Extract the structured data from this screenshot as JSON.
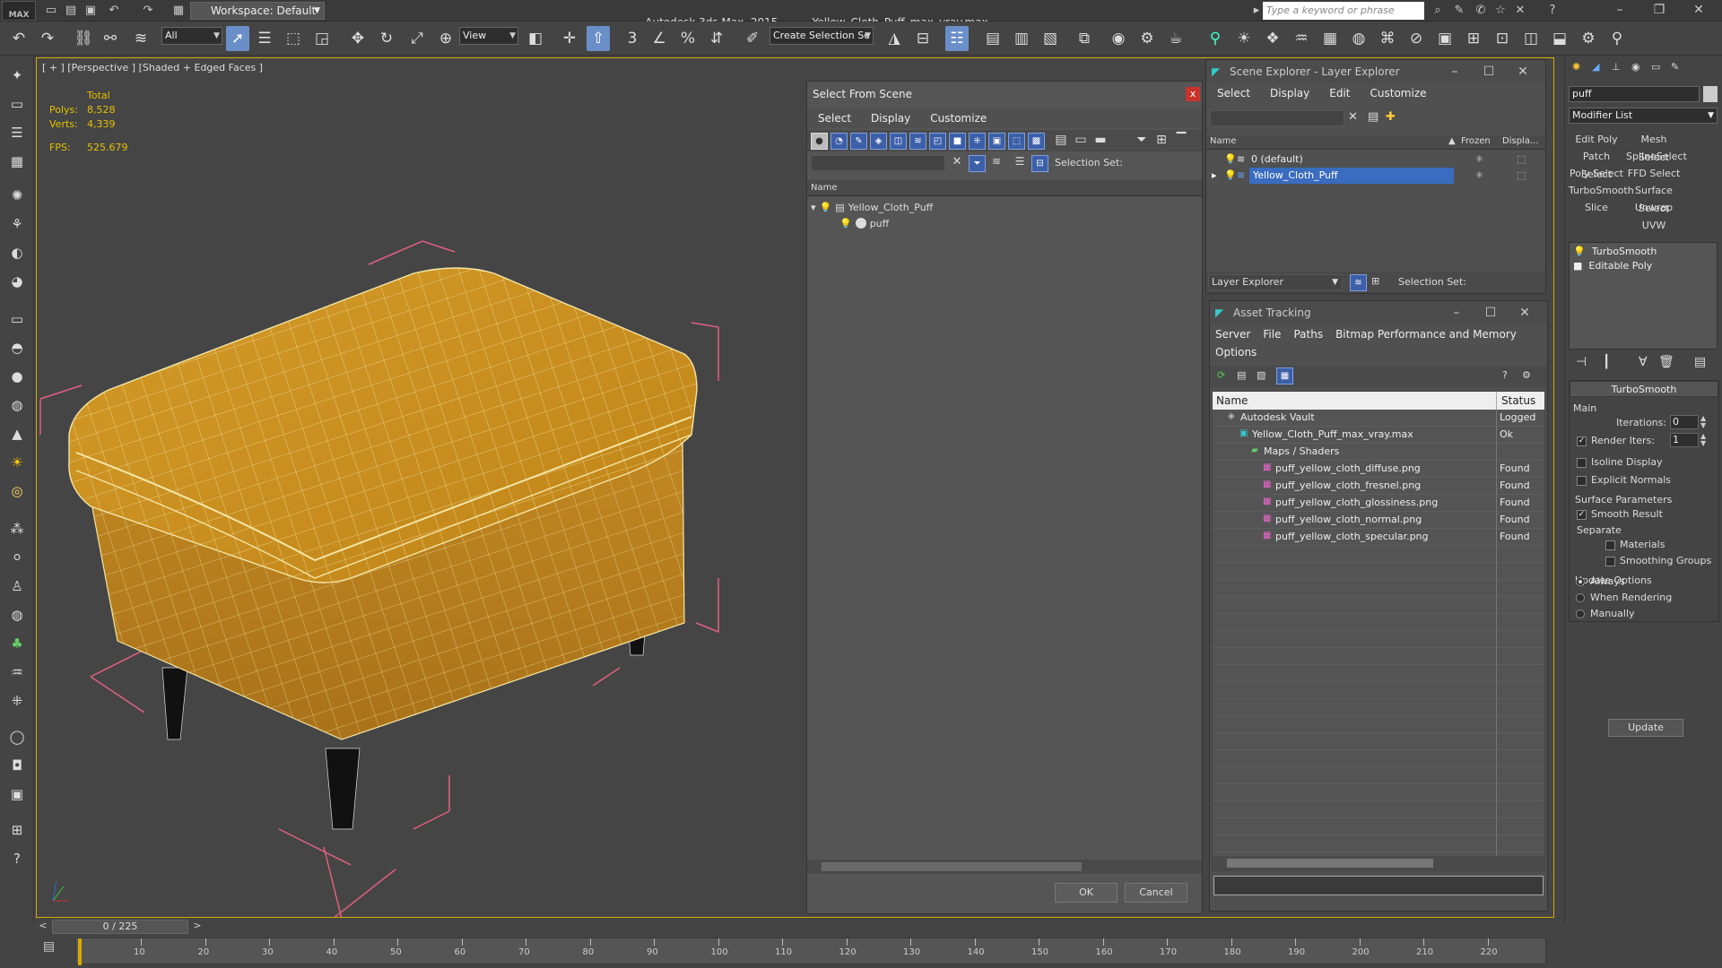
{
  "titlebar": {
    "logo": "MAX",
    "workspace": "Workspace: Default",
    "app_name": "Autodesk 3ds Max  2015",
    "file_name": "Yellow_Cloth_Puff_max_vray.max",
    "search_placeholder": "Type a keyword or phrase"
  },
  "toolbar": {
    "selection_filter": "All",
    "ref_coord": "View",
    "named_selection": "Create Selection Se"
  },
  "viewport": {
    "label": "[ + ] [Perspective ] [Shaded + Edged Faces ]",
    "stats": {
      "header": "Total",
      "polys_label": "Polys:",
      "polys": "8,528",
      "verts_label": "Verts:",
      "verts": "4,339",
      "fps_label": "FPS:",
      "fps": "525.679"
    }
  },
  "select_from_scene": {
    "title": "Select From Scene",
    "menu": [
      "Select",
      "Display",
      "Customize"
    ],
    "selection_set_label": "Selection Set:",
    "column_name": "Name",
    "tree": [
      {
        "label": "Yellow_Cloth_Puff",
        "level": 0
      },
      {
        "label": "puff",
        "level": 1
      }
    ],
    "ok": "OK",
    "cancel": "Cancel"
  },
  "scene_explorer": {
    "title": "Scene Explorer - Layer Explorer",
    "menu": [
      "Select",
      "Display",
      "Edit",
      "Customize"
    ],
    "columns": [
      "Name",
      "Frozen",
      "Displa..."
    ],
    "layers": [
      {
        "label": "0 (default)",
        "selected": false
      },
      {
        "label": "Yellow_Cloth_Puff",
        "selected": true
      }
    ],
    "footer_dropdown": "Layer Explorer",
    "selection_set_label": "Selection Set:"
  },
  "asset_tracking": {
    "title": "Asset Tracking",
    "menu": [
      "Server",
      "File",
      "Paths",
      "Bitmap Performance and Memory"
    ],
    "menu2": [
      "Options"
    ],
    "columns": [
      "Name",
      "Status"
    ],
    "rows": [
      {
        "label": "Autodesk Vault",
        "status": "Logged",
        "indent": 1,
        "icon": "vault"
      },
      {
        "label": "Yellow_Cloth_Puff_max_vray.max",
        "status": "Ok",
        "indent": 2,
        "icon": "max"
      },
      {
        "label": "Maps / Shaders",
        "status": "",
        "indent": 3,
        "icon": "folder"
      },
      {
        "label": "puff_yellow_cloth_diffuse.png",
        "status": "Found",
        "indent": 4,
        "icon": "png"
      },
      {
        "label": "puff_yellow_cloth_fresnel.png",
        "status": "Found",
        "indent": 4,
        "icon": "png"
      },
      {
        "label": "puff_yellow_cloth_glossiness.png",
        "status": "Found",
        "indent": 4,
        "icon": "png"
      },
      {
        "label": "puff_yellow_cloth_normal.png",
        "status": "Found",
        "indent": 4,
        "icon": "png"
      },
      {
        "label": "puff_yellow_cloth_specular.png",
        "status": "Found",
        "indent": 4,
        "icon": "png"
      }
    ]
  },
  "command_panel": {
    "object_name": "puff",
    "modifier_list": "Modifier List",
    "modifier_buttons": [
      [
        "Edit Poly",
        "Mesh Select"
      ],
      [
        "Patch Select",
        "SplineSelect"
      ],
      [
        "Poly Select",
        "FFD Select"
      ],
      [
        "TurboSmooth",
        "Surface Select"
      ],
      [
        "Slice",
        "Unwrap UVW"
      ]
    ],
    "stack": [
      "TurboSmooth",
      "Editable Poly"
    ],
    "turbosmooth": {
      "title": "TurboSmooth",
      "main": "Main",
      "iterations_label": "Iterations:",
      "iterations": "0",
      "render_iters_label": "Render Iters:",
      "render_iters": "1",
      "isoline": "Isoline Display",
      "explicit_normals": "Explicit Normals",
      "surface_params": "Surface Parameters",
      "smooth_result": "Smooth Result",
      "separate": "Separate",
      "materials": "Materials",
      "smoothing_groups": "Smoothing Groups",
      "update_options": "Update Options",
      "always": "Always",
      "when_rendering": "When Rendering",
      "manually": "Manually",
      "update": "Update"
    }
  },
  "timeline": {
    "frame": "0 / 225",
    "ticks": [
      "10",
      "20",
      "30",
      "40",
      "50",
      "60",
      "70",
      "80",
      "90",
      "100",
      "110",
      "120",
      "130",
      "140",
      "150",
      "160",
      "170",
      "180",
      "190",
      "200",
      "210",
      "220"
    ]
  }
}
